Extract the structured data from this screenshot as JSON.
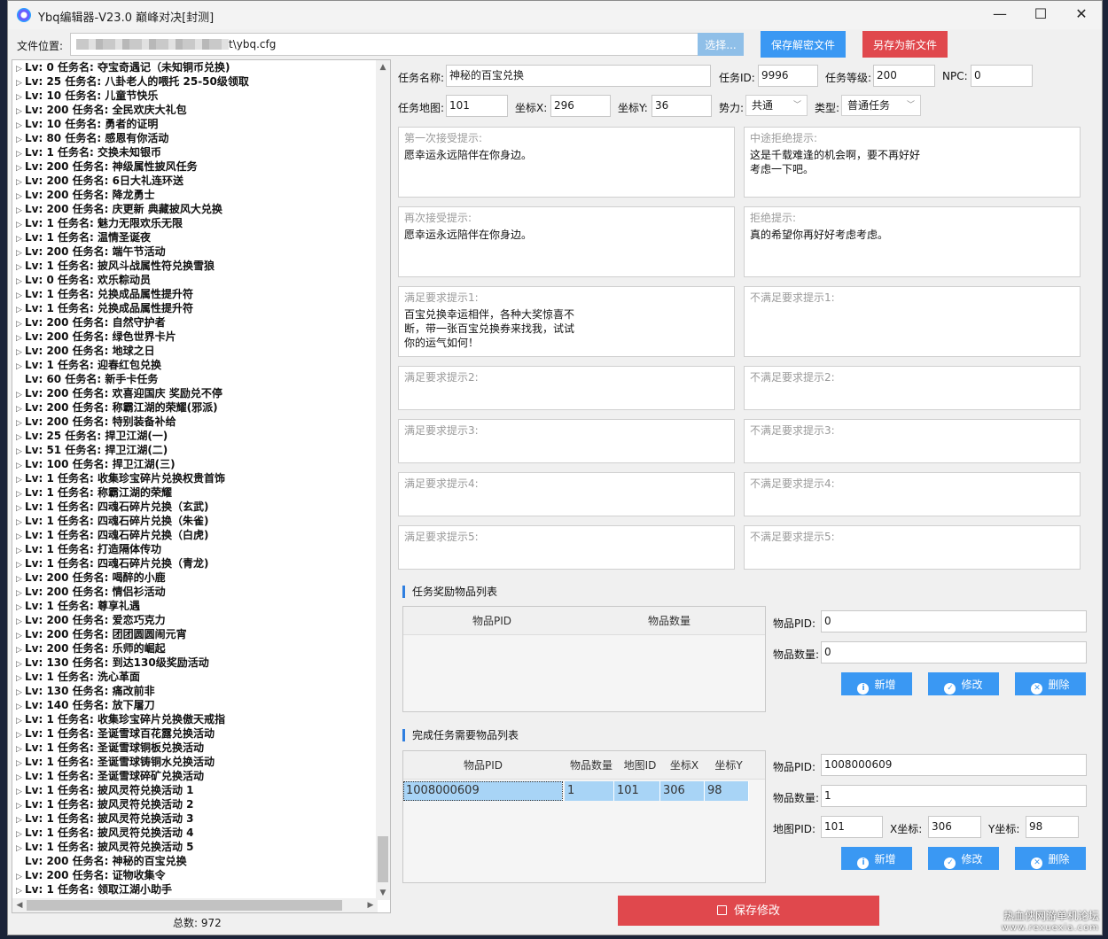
{
  "window": {
    "title": "Ybq编辑器-V23.0 巅峰对决[封测]",
    "min": "—",
    "max": "☐",
    "close": "✕"
  },
  "toolbar": {
    "file_label": "文件位置:",
    "file_path_suffix": "t\\ybq.cfg",
    "browse": "选择...",
    "save_decrypted": "保存解密文件",
    "save_as": "另存为新文件"
  },
  "tree": {
    "items": [
      {
        "lv": "0",
        "name": "夺宝奇遇记（未知铜币兑换)",
        "expand": true
      },
      {
        "lv": "25",
        "name": "八卦老人的喂托 25-50级领取",
        "expand": true
      },
      {
        "lv": "10",
        "name": "儿童节快乐",
        "expand": true
      },
      {
        "lv": "200",
        "name": "全民欢庆大礼包",
        "expand": true
      },
      {
        "lv": "10",
        "name": "勇者的证明",
        "expand": true
      },
      {
        "lv": "80",
        "name": "感恩有你活动",
        "expand": true
      },
      {
        "lv": "1",
        "name": "交换未知银币",
        "expand": true
      },
      {
        "lv": "200",
        "name": "神级属性披风任务",
        "expand": true
      },
      {
        "lv": "200",
        "name": "6日大礼连环送",
        "expand": true
      },
      {
        "lv": "200",
        "name": "降龙勇士",
        "expand": true
      },
      {
        "lv": "200",
        "name": "庆更新 典藏披风大兑换",
        "expand": true
      },
      {
        "lv": "1",
        "name": "魅力无限欢乐无限",
        "expand": true
      },
      {
        "lv": "1",
        "name": "温情圣诞夜",
        "expand": true
      },
      {
        "lv": "200",
        "name": "端午节活动",
        "expand": true
      },
      {
        "lv": "1",
        "name": "披风斗战属性符兑换雪狼",
        "expand": true
      },
      {
        "lv": "0",
        "name": "欢乐粽动员",
        "expand": true
      },
      {
        "lv": "1",
        "name": "兑换成品属性提升符",
        "expand": true
      },
      {
        "lv": "1",
        "name": "兑换成品属性提升符",
        "expand": true
      },
      {
        "lv": "200",
        "name": "自然守护者",
        "expand": true
      },
      {
        "lv": "200",
        "name": "绿色世界卡片",
        "expand": true
      },
      {
        "lv": "200",
        "name": "地球之日",
        "expand": true
      },
      {
        "lv": "1",
        "name": "迎春红包兑换",
        "expand": true
      },
      {
        "lv": "60",
        "name": "新手卡任务",
        "expand": false
      },
      {
        "lv": "200",
        "name": "欢喜迎国庆 奖励兑不停",
        "expand": true
      },
      {
        "lv": "200",
        "name": "称霸江湖的荣耀(邪派)",
        "expand": true
      },
      {
        "lv": "200",
        "name": "特别装备补给",
        "expand": true
      },
      {
        "lv": "25",
        "name": "捍卫江湖(一)",
        "expand": true
      },
      {
        "lv": "51",
        "name": "捍卫江湖(二)",
        "expand": true
      },
      {
        "lv": "100",
        "name": "捍卫江湖(三)",
        "expand": true
      },
      {
        "lv": "1",
        "name": "收集珍宝碎片兑换权贵首饰",
        "expand": true
      },
      {
        "lv": "1",
        "name": "称霸江湖的荣耀",
        "expand": true
      },
      {
        "lv": "1",
        "name": "四魂石碎片兑换（玄武)",
        "expand": true
      },
      {
        "lv": "1",
        "name": "四魂石碎片兑换（朱雀)",
        "expand": true
      },
      {
        "lv": "1",
        "name": "四魂石碎片兑换（白虎)",
        "expand": true
      },
      {
        "lv": "1",
        "name": "打造隔体传功",
        "expand": true
      },
      {
        "lv": "1",
        "name": "四魂石碎片兑换（青龙)",
        "expand": true
      },
      {
        "lv": "200",
        "name": "喝醉的小鹿",
        "expand": true
      },
      {
        "lv": "200",
        "name": "情侣衫活动",
        "expand": true
      },
      {
        "lv": "1",
        "name": "尊享礼遇",
        "expand": true
      },
      {
        "lv": "200",
        "name": "爱恋巧克力",
        "expand": true
      },
      {
        "lv": "200",
        "name": "团团圆圆闹元宵",
        "expand": true
      },
      {
        "lv": "200",
        "name": "乐师的崛起",
        "expand": true
      },
      {
        "lv": "130",
        "name": "到达130级奖励活动",
        "expand": true
      },
      {
        "lv": "1",
        "name": "洗心革面",
        "expand": true
      },
      {
        "lv": "130",
        "name": "痛改前非",
        "expand": true
      },
      {
        "lv": "140",
        "name": "放下屠刀",
        "expand": true
      },
      {
        "lv": "1",
        "name": "收集珍宝碎片兑换傲天戒指",
        "expand": true
      },
      {
        "lv": "1",
        "name": "圣诞雪球百花露兑换活动",
        "expand": true
      },
      {
        "lv": "1",
        "name": "圣诞雪球铜板兑换活动",
        "expand": true
      },
      {
        "lv": "1",
        "name": "圣诞雪球铸铜水兑换活动",
        "expand": true
      },
      {
        "lv": "1",
        "name": "圣诞雪球碎矿兑换活动",
        "expand": true
      },
      {
        "lv": "1",
        "name": "披风灵符兑换活动 1",
        "expand": true
      },
      {
        "lv": "1",
        "name": "披风灵符兑换活动 2",
        "expand": true
      },
      {
        "lv": "1",
        "name": "披风灵符兑换活动 3",
        "expand": true
      },
      {
        "lv": "1",
        "name": "披风灵符兑换活动 4",
        "expand": true
      },
      {
        "lv": "1",
        "name": "披风灵符兑换活动 5",
        "expand": true
      },
      {
        "lv": "200",
        "name": "神秘的百宝兑换",
        "expand": false
      },
      {
        "lv": "200",
        "name": "证物收集令",
        "expand": true
      },
      {
        "lv": "1",
        "name": "领取江湖小助手",
        "expand": true
      }
    ],
    "lv_prefix": "Lv:",
    "name_prefix": "任务名:",
    "total_label": "总数: 972"
  },
  "form": {
    "task_name_label": "任务名称:",
    "task_name": "神秘的百宝兑换",
    "task_id_label": "任务ID:",
    "task_id": "9996",
    "task_level_label": "任务等级:",
    "task_level": "200",
    "npc_label": "NPC:",
    "npc": "0",
    "map_label": "任务地图:",
    "map": "101",
    "x_label": "坐标X:",
    "x": "296",
    "y_label": "坐标Y:",
    "y": "36",
    "faction_label": "势力:",
    "faction": "共通",
    "type_label": "类型:",
    "type": "普通任务"
  },
  "prompts": [
    {
      "label": "第一次接受提示:",
      "text": "愿幸运永远陪伴在你身边。"
    },
    {
      "label": "中途拒绝提示:",
      "text": "这是千载难逢的机会啊，要不再好好\n考虑一下吧。"
    },
    {
      "label": "再次接受提示:",
      "text": "愿幸运永远陪伴在你身边。"
    },
    {
      "label": "拒绝提示:",
      "text": "真的希望你再好好考虑考虑。"
    },
    {
      "label": "满足要求提示1:",
      "text": "百宝兑换幸运相伴，各种大奖惊喜不\n断，带一张百宝兑换券来找我，试试\n你的运气如何！"
    },
    {
      "label": "不满足要求提示1:",
      "text": ""
    },
    {
      "label": "满足要求提示2:",
      "text": ""
    },
    {
      "label": "不满足要求提示2:",
      "text": ""
    },
    {
      "label": "满足要求提示3:",
      "text": ""
    },
    {
      "label": "不满足要求提示3:",
      "text": ""
    },
    {
      "label": "满足要求提示4:",
      "text": ""
    },
    {
      "label": "不满足要求提示4:",
      "text": ""
    },
    {
      "label": "满足要求提示5:",
      "text": ""
    },
    {
      "label": "不满足要求提示5:",
      "text": ""
    }
  ],
  "reward": {
    "section_title": "任务奖励物品列表",
    "col_pid": "物品PID",
    "col_qty": "物品数量",
    "pid_label": "物品PID:",
    "pid": "0",
    "qty_label": "物品数量:",
    "qty": "0",
    "add": "新增",
    "edit": "修改",
    "delete": "删除"
  },
  "required": {
    "section_title": "完成任务需要物品列表",
    "columns": [
      "物品PID",
      "物品数量",
      "地图ID",
      "坐标X",
      "坐标Y"
    ],
    "row": [
      "1008000609",
      "1",
      "101",
      "306",
      "98"
    ],
    "pid_label": "物品PID:",
    "pid": "1008000609",
    "qty_label": "物品数量:",
    "qty": "1",
    "map_label": "地图PID:",
    "map": "101",
    "x_label": "X坐标:",
    "x": "306",
    "y_label": "Y坐标:",
    "y": "98",
    "add": "新增",
    "edit": "修改",
    "delete": "删除"
  },
  "commit_label": "保存修改",
  "watermark": {
    "line1": "热血侠网游单机论坛",
    "line2": "www.rexuexia.com"
  }
}
